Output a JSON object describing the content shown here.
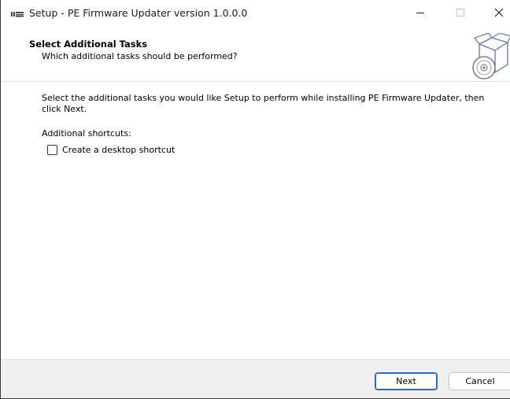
{
  "window": {
    "title": "Setup - PE Firmware Updater version 1.0.0.0",
    "controls": {
      "minimize": "—",
      "maximize": "☐",
      "close": "✕"
    }
  },
  "header": {
    "title": "Select Additional Tasks",
    "subtitle": "Which additional tasks should be performed?",
    "image_icon": "software-box-cd-icon"
  },
  "body": {
    "description": "Select the additional tasks you would like Setup to perform while installing PE Firmware Updater, then click Next.",
    "section_label": "Additional shortcuts:",
    "tasks": [
      {
        "label": "Create a desktop shortcut",
        "checked": false
      }
    ]
  },
  "footer": {
    "next_label": "Next",
    "cancel_label": "Cancel"
  },
  "colors": {
    "footer_bg": "#f0f0f0",
    "default_button_border": "#2a6ac9"
  }
}
